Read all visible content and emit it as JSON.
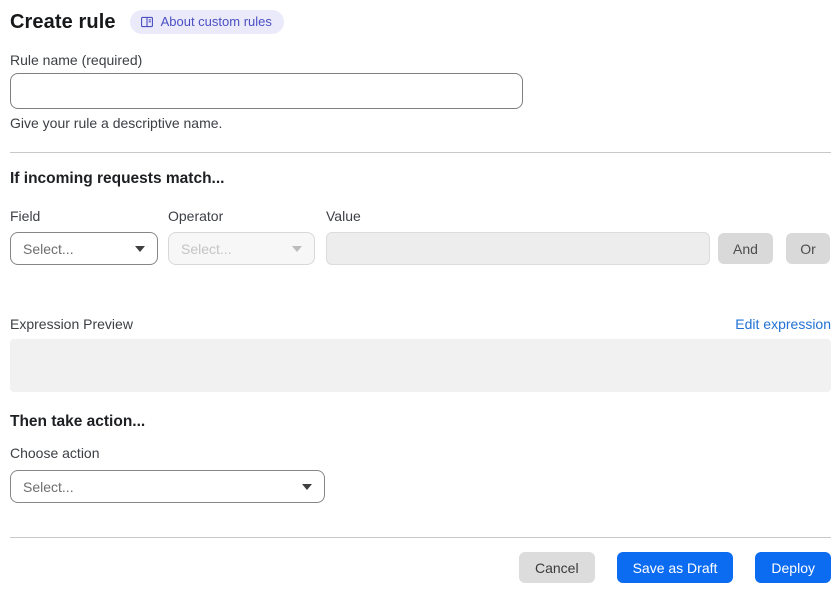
{
  "page": {
    "title": "Create rule",
    "badge_label": "About custom rules"
  },
  "rule_name": {
    "label": "Rule name (required)",
    "value": "",
    "help": "Give your rule a descriptive name."
  },
  "match_section": {
    "heading": "If incoming requests match...",
    "field": {
      "label": "Field",
      "placeholder": "Select..."
    },
    "operator": {
      "label": "Operator",
      "placeholder": "Select..."
    },
    "value": {
      "label": "Value",
      "value": ""
    },
    "and_label": "And",
    "or_label": "Or",
    "expression_preview_label": "Expression Preview",
    "edit_expression_label": "Edit expression",
    "expression_value": ""
  },
  "action_section": {
    "heading": "Then take action...",
    "choose_action_label": "Choose action",
    "placeholder": "Select..."
  },
  "footer": {
    "cancel_label": "Cancel",
    "save_draft_label": "Save as Draft",
    "deploy_label": "Deploy"
  },
  "colors": {
    "primary_blue": "#0b6cf2",
    "link_blue": "#2271d4",
    "badge_bg": "#ebeafa",
    "badge_text": "#4a50c2",
    "neutral_button": "#d9d9d9",
    "disabled_field_bg": "#ededed",
    "preview_bg": "#f1f1f1"
  }
}
